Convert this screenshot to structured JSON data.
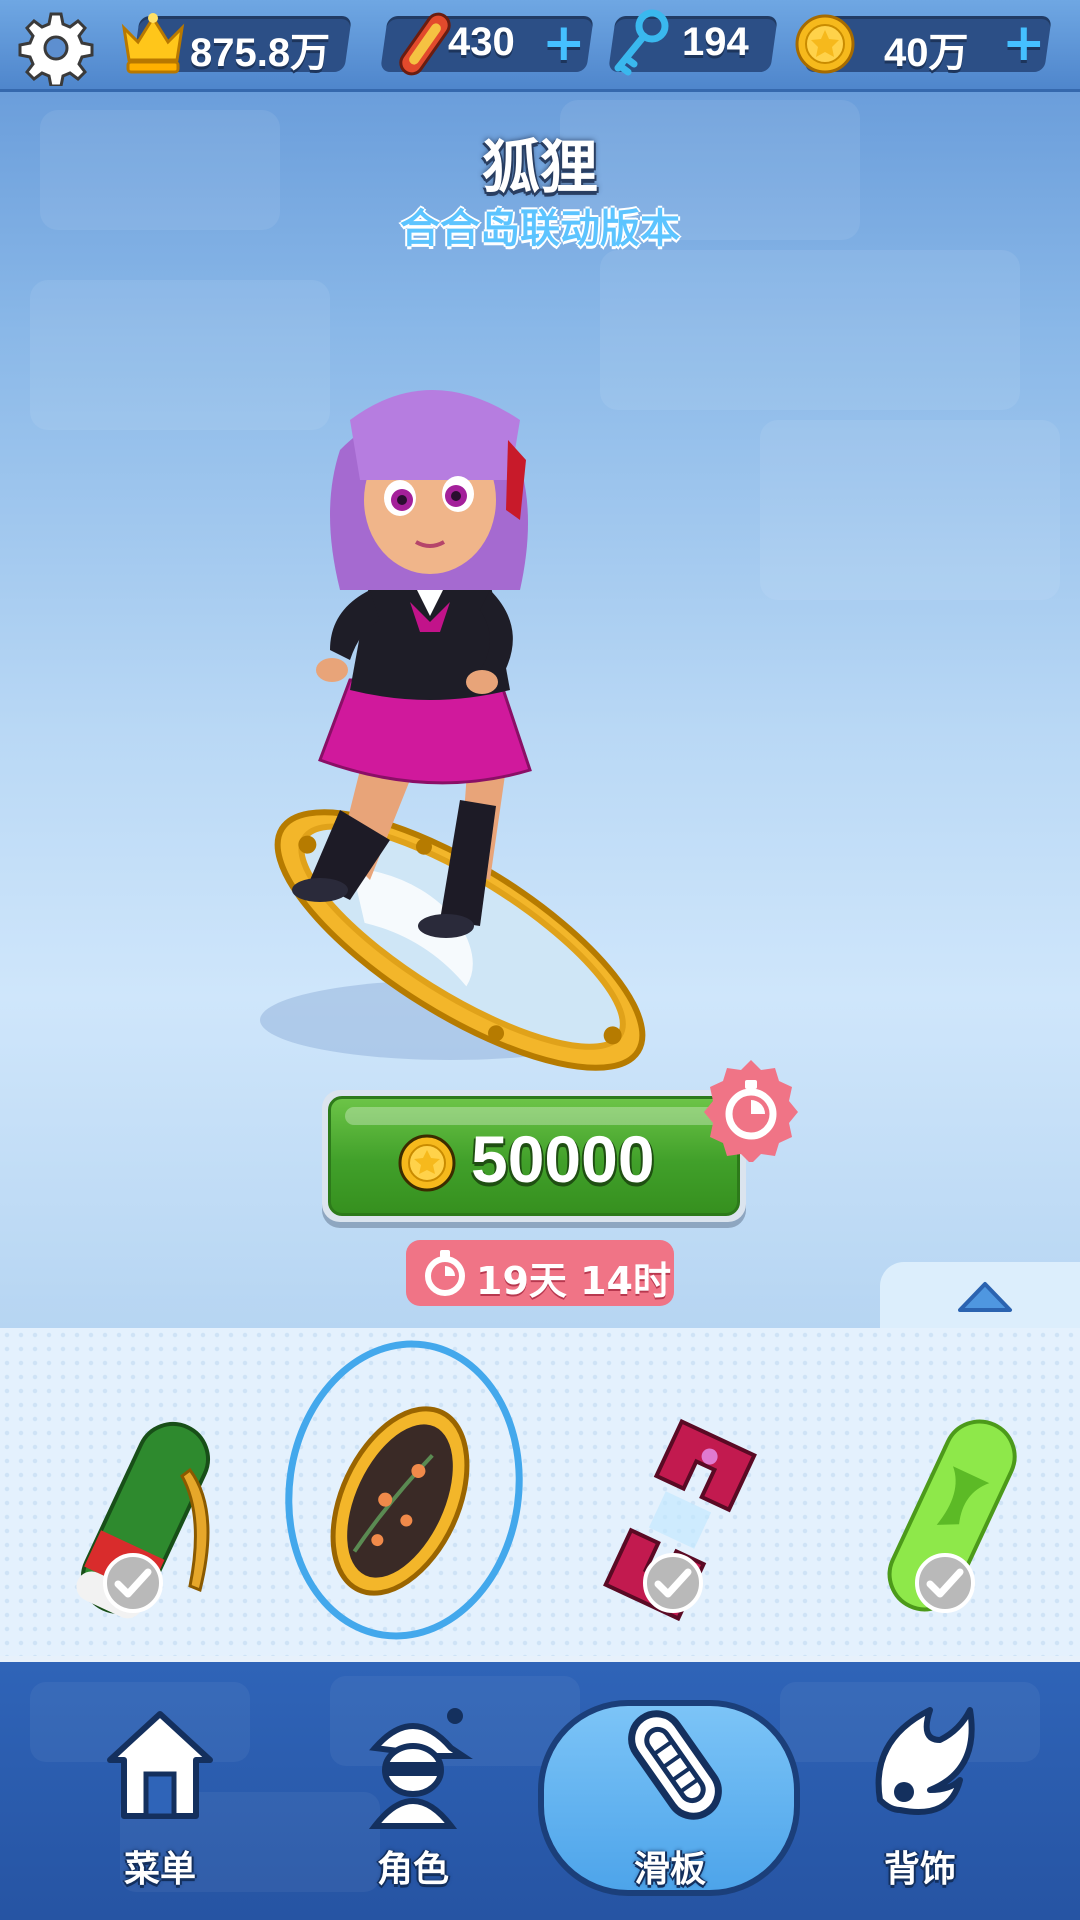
{
  "header": {
    "settings_icon": "gear-icon",
    "resources": [
      {
        "name": "trophy",
        "icon": "crown-icon",
        "value": "875.8万",
        "has_plus": false
      },
      {
        "name": "boards",
        "icon": "hoverboard-icon",
        "value": "430",
        "has_plus": true
      },
      {
        "name": "keys",
        "icon": "key-icon",
        "value": "194",
        "has_plus": false
      },
      {
        "name": "coins",
        "icon": "coin-icon",
        "value": "40万",
        "has_plus": true
      }
    ]
  },
  "item": {
    "name": "狐狸",
    "edition": "合合岛联动版本"
  },
  "purchase": {
    "price": "50000",
    "currency_icon": "coin-icon",
    "limited_icon": "stopwatch-icon",
    "time_left": "19天 14时"
  },
  "selector": {
    "boards": [
      {
        "name": "green-saxophone-board",
        "owned": true,
        "selected": false
      },
      {
        "name": "golden-mirror-board",
        "owned": false,
        "selected": true
      },
      {
        "name": "magnet-board",
        "owned": true,
        "selected": false
      },
      {
        "name": "green-slime-board",
        "owned": true,
        "selected": false
      }
    ]
  },
  "nav": {
    "items": [
      {
        "label": "菜单",
        "icon": "home-icon",
        "active": false
      },
      {
        "label": "角色",
        "icon": "character-icon",
        "active": false
      },
      {
        "label": "滑板",
        "icon": "hoverboard-icon",
        "active": true
      },
      {
        "label": "背饰",
        "icon": "wing-icon",
        "active": false
      }
    ]
  },
  "colors": {
    "buy_button": "#41a02a",
    "timer_pill": "#f07486",
    "nav_bg": "#2f64b8",
    "accent_blue": "#43a8ec"
  }
}
